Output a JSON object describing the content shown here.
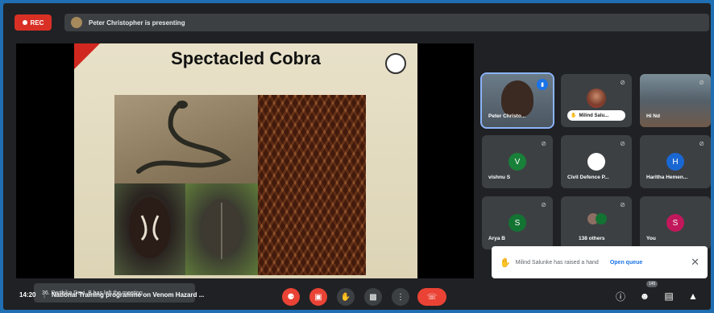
{
  "topbar": {
    "rec_label": "REC",
    "presenting_text": "Peter Christopher is presenting"
  },
  "slide": {
    "title": "Spectacled Cobra"
  },
  "participants": [
    {
      "name": "Peter Christo...",
      "initial": "",
      "avatar_color": ""
    },
    {
      "name": "Milind Salu...",
      "initial": "",
      "avatar_color": ""
    },
    {
      "name": "Hi Nd",
      "initial": "",
      "avatar_color": ""
    },
    {
      "name": "vishnu S",
      "initial": "V",
      "avatar_color": "#188038"
    },
    {
      "name": "Civil Defence P...",
      "initial": "",
      "avatar_color": ""
    },
    {
      "name": "Haritha Hemen...",
      "initial": "H",
      "avatar_color": "#1967d2"
    },
    {
      "name": "Arya B",
      "initial": "S",
      "avatar_color": "#137333"
    },
    {
      "name": "138 others",
      "initial": "",
      "avatar_color": ""
    },
    {
      "name": "You",
      "initial": "S",
      "avatar_color": "#c2185b"
    }
  ],
  "notifications": {
    "left_toast": "36. Parthika Devi. B has left the meeting",
    "hand_raised": "Milind Salunke has raised a hand",
    "open_queue": "Open queue"
  },
  "bottombar": {
    "time": "14:20",
    "separator": "|",
    "meeting_title": "National Training programme on Venom Hazard ...",
    "people_badge": "145"
  },
  "colors": {
    "accent": "#1a73e8",
    "danger": "#ea4335",
    "surface": "#3c4043",
    "background": "#202124"
  }
}
